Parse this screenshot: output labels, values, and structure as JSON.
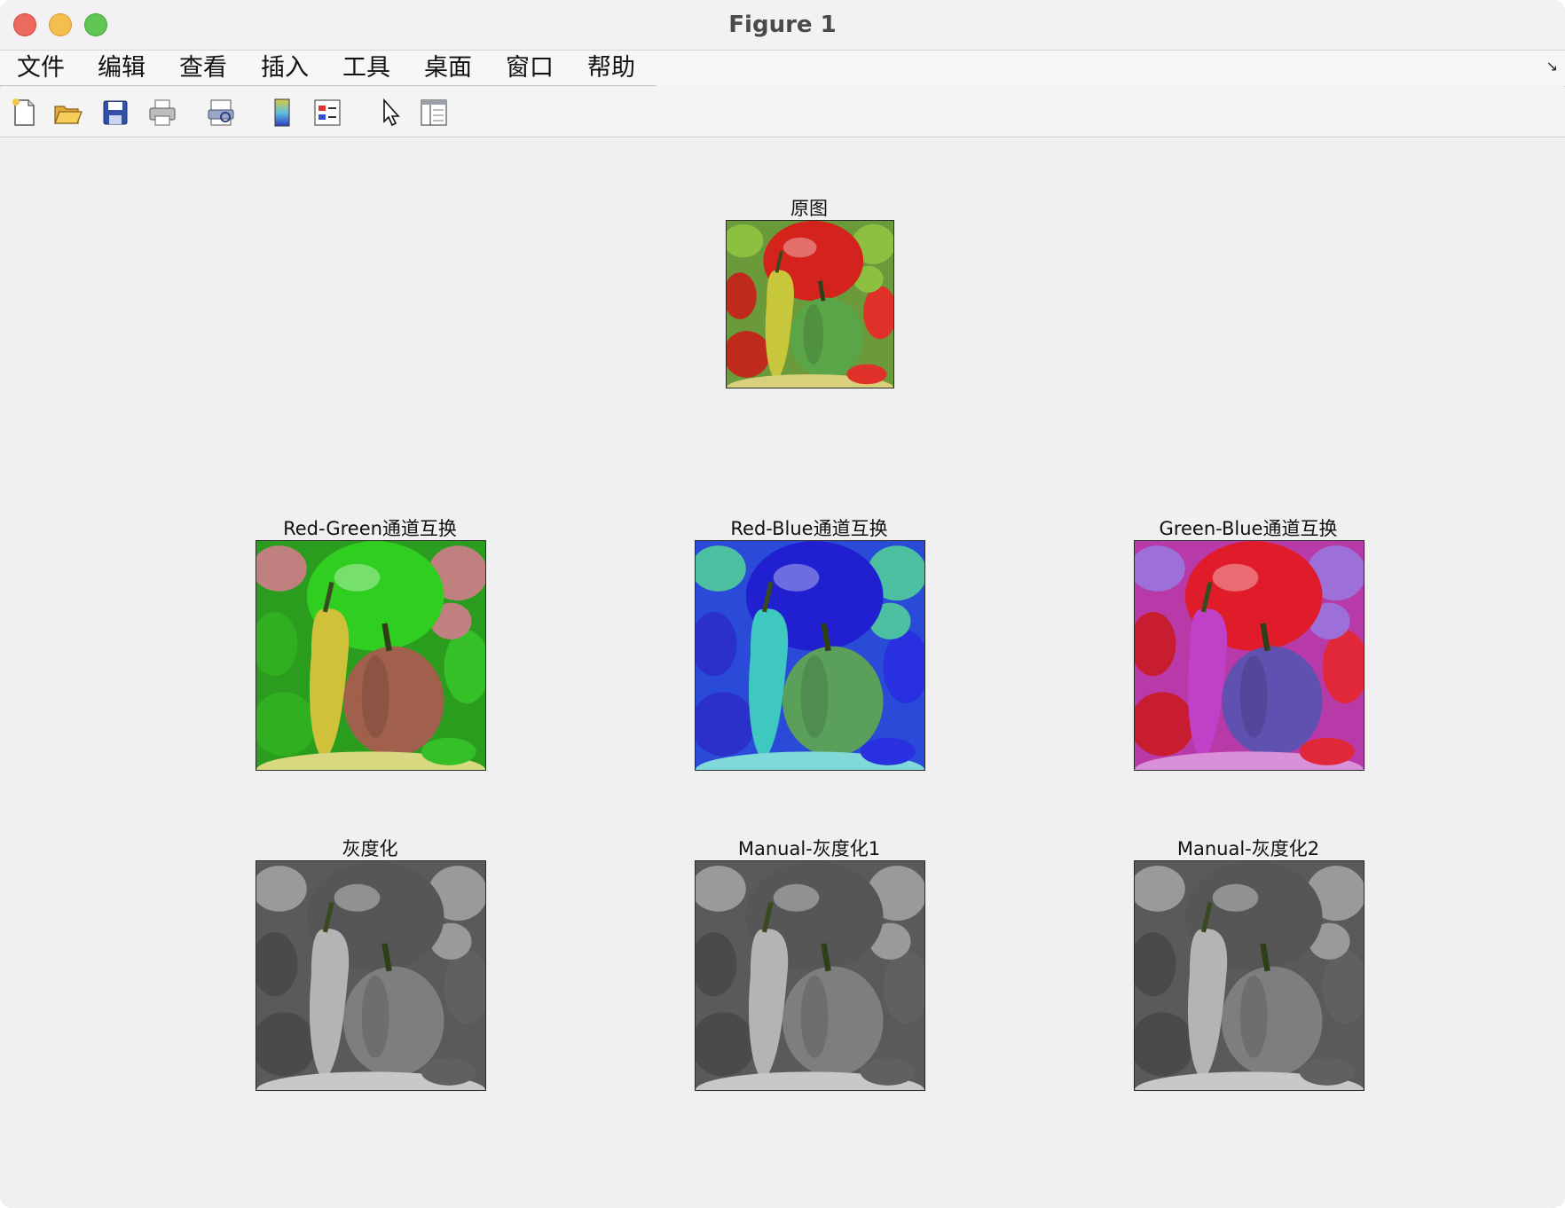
{
  "window": {
    "title": "Figure 1"
  },
  "menu": [
    "文件",
    "编辑",
    "查看",
    "插入",
    "工具",
    "桌面",
    "窗口",
    "帮助"
  ],
  "toolbar": {
    "buttons": [
      "new-figure",
      "open-file",
      "save",
      "print",
      "print-preview",
      "insert-colorbar",
      "insert-legend",
      "edit-plot",
      "show-plot-tools"
    ]
  },
  "axes": [
    {
      "title": "原图",
      "palette": "original"
    },
    {
      "title": "Red-Green通道互换",
      "palette": "rg"
    },
    {
      "title": "Red-Blue通道互换",
      "palette": "rb"
    },
    {
      "title": "Green-Blue通道互换",
      "palette": "gb"
    },
    {
      "title": "灰度化",
      "palette": "gray"
    },
    {
      "title": "Manual-灰度化1",
      "palette": "gray"
    },
    {
      "title": "Manual-灰度化2",
      "palette": "gray"
    }
  ],
  "colors": {
    "original": {
      "bg": "#6a9a3a",
      "big": "#d4221c",
      "tall": "#c8c63a",
      "center": "#5aa548",
      "side1": "#c02a1c",
      "side2": "#8cc040",
      "side3": "#e0302a",
      "bottom": "#d8d07a"
    },
    "rg": {
      "bg": "#2a9c1e",
      "big": "#2fce20",
      "tall": "#cfc23a",
      "center": "#a0604c",
      "side1": "#30b020",
      "side2": "#c08080",
      "side3": "#36c028",
      "bottom": "#d8d880"
    },
    "rb": {
      "bg": "#2a4ad8",
      "big": "#2020d0",
      "tall": "#3ec8c0",
      "center": "#5aa05a",
      "side1": "#2a30c8",
      "side2": "#4cc0a0",
      "side3": "#2830e0",
      "bottom": "#80d8d8"
    },
    "gb": {
      "bg": "#b83aa8",
      "big": "#e01c2a",
      "tall": "#c040c8",
      "center": "#6050b0",
      "side1": "#c81c30",
      "side2": "#9c70d8",
      "side3": "#e02838",
      "bottom": "#d890d8"
    },
    "gray": {
      "bg": "#5a5a5a",
      "big": "#565656",
      "tall": "#b4b4b4",
      "center": "#7e7e7e",
      "side1": "#4a4a4a",
      "side2": "#9a9a9a",
      "side3": "#606060",
      "bottom": "#c8c8c8"
    }
  }
}
